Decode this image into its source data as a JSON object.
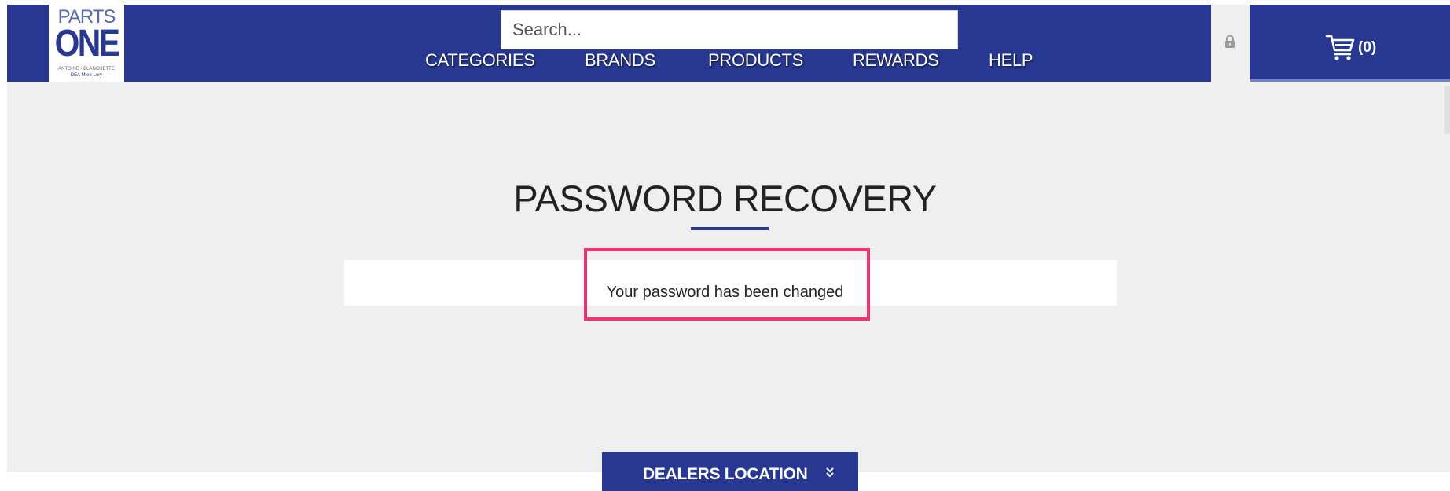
{
  "logo": {
    "top_text": "PARTS",
    "big_text": "ONE",
    "sub_text": "ANTOINE • BLANCHETTE",
    "sub_text2": "DEA Mtee Lory"
  },
  "search": {
    "placeholder": "Search..."
  },
  "nav": {
    "items": [
      {
        "label": "CATEGORIES"
      },
      {
        "label": "BRANDS"
      },
      {
        "label": "PRODUCTS"
      },
      {
        "label": "REWARDS"
      },
      {
        "label": "HELP"
      }
    ]
  },
  "account": {
    "icon": "lock-icon"
  },
  "cart": {
    "icon": "cart-icon",
    "count": "(0)"
  },
  "main": {
    "title": "PASSWORD RECOVERY",
    "message": "Your password has been changed"
  },
  "footer": {
    "dealers_label": "DEALERS LOCATION",
    "dealers_icon": "double-chevron-down-icon"
  },
  "colors": {
    "brand_blue": "#283890",
    "background": "#efefef",
    "highlight": "#f0336f"
  }
}
